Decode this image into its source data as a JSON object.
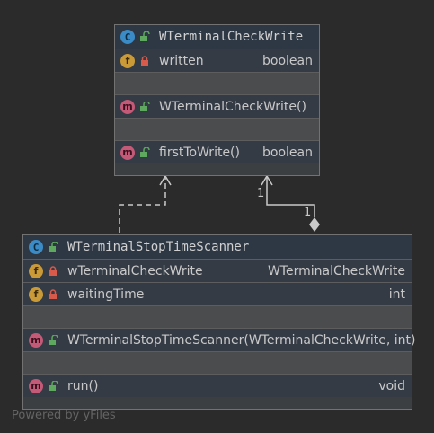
{
  "classes": {
    "check_write": {
      "name": "WTerminalCheckWrite",
      "fields": [
        {
          "name": "written",
          "type": "boolean"
        }
      ],
      "constructor": {
        "name": "WTerminalCheckWrite()"
      },
      "methods": [
        {
          "name": "firstToWrite()",
          "type": "boolean"
        }
      ]
    },
    "scanner": {
      "name": "WTerminalStopTimeScanner",
      "fields": [
        {
          "name": "wTerminalCheckWrite",
          "type": "WTerminalCheckWrite"
        },
        {
          "name": "waitingTime",
          "type": "int"
        }
      ],
      "constructor": {
        "name": "WTerminalStopTimeScanner(WTerminalCheckWrite, int)"
      },
      "methods": [
        {
          "name": "run()",
          "type": "void"
        }
      ]
    }
  },
  "badges": {
    "class": "C",
    "field": "f",
    "method": "m"
  },
  "multiplicity": {
    "target_end": "1",
    "source_end": "1"
  },
  "watermark": "Powered by yFiles",
  "colors": {
    "background": "#2b2b2b",
    "class_badge": "#3b8bc6",
    "field_badge": "#c99a37",
    "method_badge": "#c25a78",
    "public_lock": "#5fa85f",
    "private_lock": "#d75a4a",
    "edge": "#c9c9c9"
  },
  "icons": [
    "class-icon",
    "field-icon",
    "method-icon",
    "public-unlock-icon",
    "private-lock-icon"
  ]
}
